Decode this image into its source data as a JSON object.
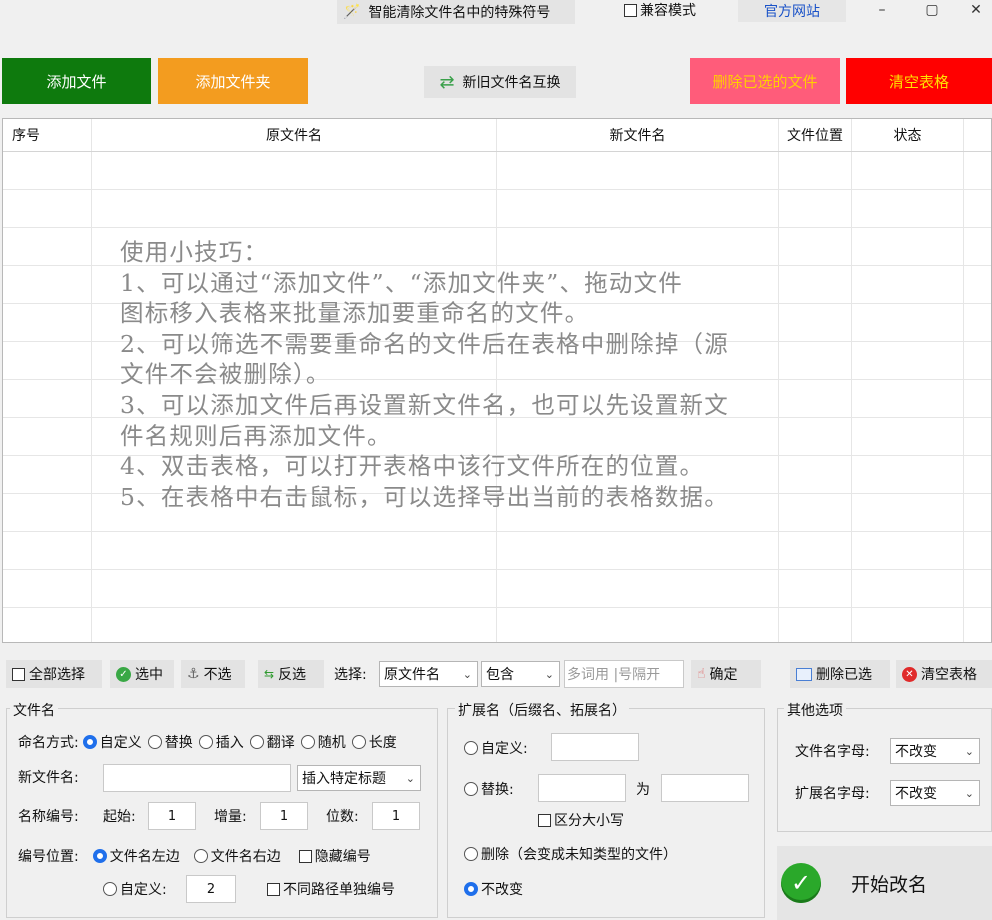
{
  "titlebar": {
    "title": "智能清除文件名中的特殊符号",
    "compat_label": "兼容模式",
    "site_label": "官方网站",
    "min": "–",
    "max": "▢",
    "close": "✕"
  },
  "toolbar": {
    "add_file": "添加文件",
    "add_folder": "添加文件夹",
    "swap_names": "新旧文件名互换",
    "delete_selected": "删除已选的文件",
    "clear_table": "清空表格"
  },
  "table": {
    "columns": [
      "序号",
      "原文件名",
      "新文件名",
      "文件位置",
      "状态"
    ]
  },
  "tips": {
    "title": "使用小技巧：",
    "lines": [
      "1、可以通过“添加文件”、“添加文件夹”、拖动文件",
      "图标移入表格来批量添加要重命名的文件。",
      "2、可以筛选不需要重命名的文件后在表格中删除掉（源",
      "文件不会被删除）。",
      "3、可以添加文件后再设置新文件名，也可以先设置新文",
      "件名规则后再添加文件。",
      "4、双击表格，可以打开表格中该行文件所在的位置。",
      "5、在表格中右击鼠标，可以选择导出当前的表格数据。"
    ]
  },
  "selectbar": {
    "select_all": "全部选择",
    "check": "选中",
    "uncheck": "不选",
    "invert": "反选",
    "choose_label": "选择:",
    "field": "原文件名",
    "mode": "包含",
    "keyword_placeholder": "多词用 |号隔开",
    "confirm": "确定",
    "delete_checked": "删除已选",
    "clear_table": "清空表格"
  },
  "filename_group": {
    "title": "文件名",
    "mode_label": "命名方式:",
    "modes": [
      "自定义",
      "替换",
      "插入",
      "翻译",
      "随机",
      "长度"
    ],
    "new_name_label": "新文件名:",
    "new_name_value": "",
    "insert_title": "插入特定标题",
    "numbering_label": "名称编号:",
    "start_label": "起始:",
    "start_value": "1",
    "step_label": "增量:",
    "step_value": "1",
    "digits_label": "位数:",
    "digits_value": "1",
    "position_label": "编号位置:",
    "pos_left": "文件名左边",
    "pos_right": "文件名右边",
    "hide_number": "隐藏编号",
    "pos_custom": "自定义:",
    "pos_custom_value": "2",
    "separate_paths": "不同路径单独编号"
  },
  "ext_group": {
    "title": "扩展名（后缀名、拓展名）",
    "custom": "自定义:",
    "replace": "替换:",
    "to": "为",
    "case_sensitive": "区分大小写",
    "delete": "删除（会变成未知类型的文件）",
    "unchanged": "不改变"
  },
  "other_group": {
    "title": "其他选项",
    "filename_case_label": "文件名字母:",
    "filename_case_value": "不改变",
    "ext_case_label": "扩展名字母:",
    "ext_case_value": "不改变"
  },
  "start_button": "开始改名",
  "colors": {
    "add_file": "#0e7a0d",
    "add_folder": "#f39c1f",
    "delete_selected": "#ff5c7a",
    "clear_table": "#ff0000",
    "accent": "#1f6feb"
  }
}
